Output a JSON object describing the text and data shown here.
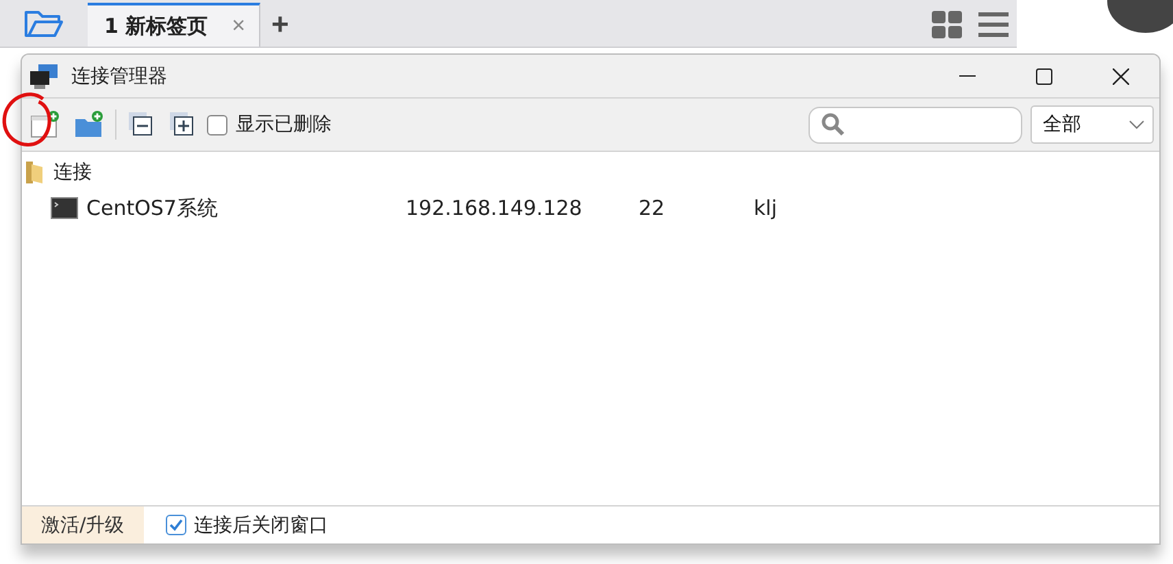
{
  "app_tabs": [
    {
      "label": "1 新标签页",
      "selected": true,
      "close": "×"
    }
  ],
  "new_tab": "+",
  "dialog": {
    "title": "连接管理器",
    "toolbar": {
      "show_deleted": {
        "label": "显示已删除",
        "checked": false
      },
      "search": {
        "kind": "field"
      },
      "filter": {
        "value": "全部"
      }
    },
    "tree": [
      {
        "label": "连接",
        "expanded": true,
        "children": [
          {
            "name": "CentOS7系统",
            "host": "192.168.149.128",
            "port": "22",
            "user": "klj"
          }
        ]
      }
    ],
    "footer": {
      "activate": "激活/升级",
      "close_after_connect": {
        "label": "连接后关闭窗口",
        "checked": true
      }
    }
  }
}
